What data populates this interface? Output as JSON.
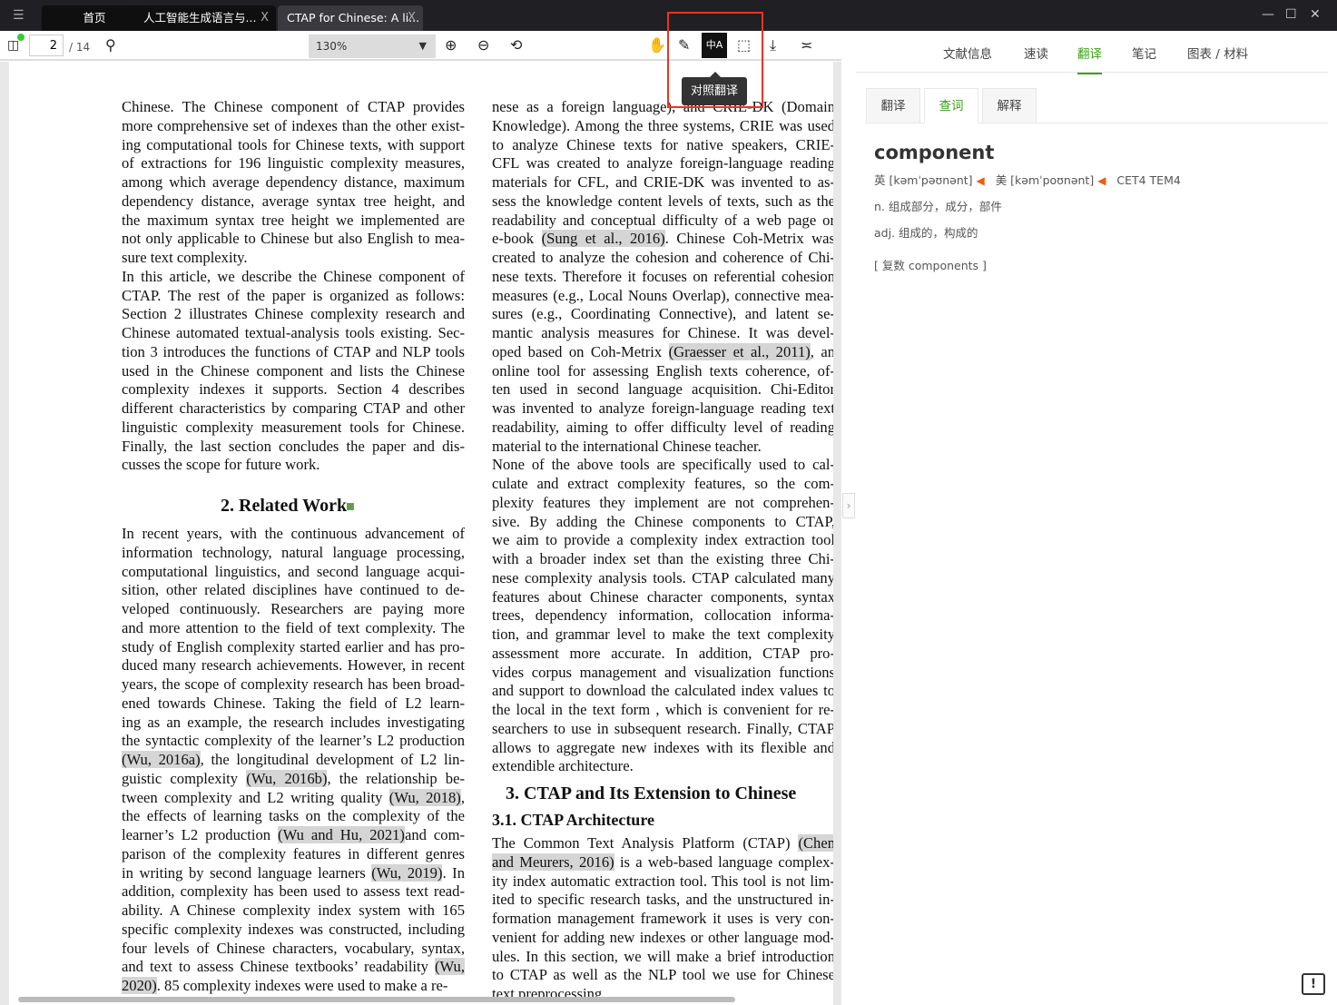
{
  "tabs": [
    {
      "label": "首页"
    },
    {
      "label": "人工智能生成语言与...",
      "close": "X"
    },
    {
      "label": "CTAP for Chinese: A li...",
      "close": "X"
    }
  ],
  "window_controls": {
    "minimize": "—",
    "maximize": "☐",
    "close": "✕"
  },
  "toolbar": {
    "page": "2",
    "page_total": "/ 14",
    "zoom": "130%",
    "translate_icon": "中A",
    "tooltip": "对照翻译"
  },
  "icons": [
    "sidebar-toggle-icon",
    "search-icon",
    "zoom-in-icon",
    "zoom-out-icon",
    "rotate-icon",
    "hand-icon",
    "pen-icon",
    "translate-icon",
    "select-area-icon",
    "download-icon",
    "eye-icon"
  ],
  "colors": {
    "accent": "#3aa017",
    "highlight_box": "#e32222",
    "cite_bg": "#d5d5d5",
    "speaker": "#f05a14"
  },
  "doc": {
    "left_paras": [
      [
        "Chinese. The Chinese component of CTAP provides",
        "more comprehensive set of indexes than the other exist-",
        "ing computational tools for Chinese texts, with support",
        "of extractions for 196 linguistic complexity measures,",
        "among which average dependency distance, maximum",
        "dependency distance, average syntax tree height, and",
        "the maximum syntax tree height we implemented are",
        "not only applicable to Chinese but also English to mea-",
        "sure text complexity."
      ],
      [
        "In this article, we describe the Chinese component of",
        "CTAP. The rest of the paper is organized as follows:",
        "Section 2 illustrates Chinese complexity research and",
        "Chinese automated textual-analysis tools existing. Sec-",
        "tion 3 introduces the functions of CTAP and NLP tools",
        "used in the Chinese component and lists the Chinese",
        "complexity indexes it supports.  Section 4 describes",
        "different characteristics by comparing CTAP and other",
        "linguistic complexity measurement tools for Chinese.",
        "Finally, the last section concludes the paper and dis-",
        "cusses the scope for future work."
      ]
    ],
    "heading2": "2.    Related Work",
    "left_paras2": [
      [
        "In recent years, with the continuous advancement of",
        "information technology, natural language processing,",
        "computational linguistics, and second language acqui-",
        "sition, other related disciplines have continued to de-",
        "veloped continuously.  Researchers are paying more",
        "and more attention to the field of text complexity. The",
        "study of English complexity started earlier and has pro-",
        "duced many research achievements. However, in recent",
        "years, the scope of complexity research has been broad-",
        "ened towards Chinese.  Taking the field of L2 learn-",
        "ing as an example, the research includes investigating",
        "the syntactic complexity of the learner’s L2 production",
        "(Wu, 2016a), the longitudinal development of L2 lin-",
        "guistic complexity (Wu, 2016b), the relationship be-",
        "tween complexity and L2 writing quality (Wu, 2018),",
        "the effects of learning tasks on the complexity of the",
        "learner’s L2 production (Wu and Hu, 2021)and com-",
        "parison of the complexity features in different genres",
        "in writing by second language learners (Wu, 2019). In",
        "addition, complexity has been used to assess text read-",
        "ability.  A Chinese complexity index system with 165",
        "specific complexity indexes was constructed, including",
        "four levels of Chinese characters, vocabulary, syntax,",
        "and text to assess Chinese textbooks’ readability (Wu,",
        "2020). 85 complexity indexes were used to make a re-"
      ]
    ],
    "right_paras": [
      [
        "nese as a foreign language), and CRIE-DK (Domain",
        "Knowledge). Among the three systems, CRIE was used",
        "to analyze Chinese texts for native speakers, CRIE-",
        "CFL was created to analyze foreign-language reading",
        "materials for CFL, and CRIE-DK was invented to as-",
        "sess the knowledge content levels of texts, such as the",
        "readability and conceptual difficulty of a web page or",
        "e-book (Sung et al., 2016).  Chinese Coh-Metrix was",
        "created to analyze the cohesion and coherence of Chi-",
        "nese texts. Therefore it focuses on referential cohesion",
        "measures (e.g., Local Nouns Overlap), connective mea-",
        "sures (e.g., Coordinating Connective), and latent se-",
        "mantic analysis measures for Chinese.  It was devel-",
        "oped based on Coh-Metrix (Graesser et al., 2011), an",
        "online tool for assessing English texts coherence, of-",
        "ten used in second language acquisition.  Chi-Editor",
        "was invented to analyze foreign-language reading text",
        "readability, aiming to offer difficulty level of reading",
        "material to the international Chinese teacher."
      ],
      [
        "None of the above tools are specifically used to cal-",
        "culate and extract complexity features, so the com-",
        "plexity features they implement are not comprehen-",
        "sive.  By adding the Chinese components to CTAP,",
        "we aim to provide a complexity index extraction tool",
        "with a broader index set than the existing three Chi-",
        "nese complexity analysis tools. CTAP calculated many",
        "features about Chinese character components, syntax",
        "trees, dependency information, collocation informa-",
        "tion, and grammar level to make the text complexity",
        "assessment more accurate.  In addition, CTAP pro-",
        "vides corpus management and visualization functions",
        "and support to download the calculated index values to",
        "the local in the text form , which is convenient for re-",
        "searchers to use in subsequent research. Finally, CTAP",
        "allows to aggregate new indexes with its flexible and",
        "extendible architecture."
      ]
    ],
    "heading3": "3.    CTAP and Its Extension to Chinese",
    "heading31": "3.1.    CTAP Architecture",
    "right_paras2": [
      [
        "The Common Text Analysis Platform (CTAP) (Chen",
        "and Meurers, 2016) is a web-based language complex-",
        "ity index automatic extraction tool. This tool is not lim-",
        "ited to specific research tasks, and the unstructured in-",
        "formation management framework it uses is very con-",
        "venient for adding new indexes or other language mod-",
        "ules. In this section, we will make a brief introduction",
        "to CTAP as well as the NLP tool we use for Chinese",
        "text preprocessing."
      ]
    ],
    "citations": [
      "(Graesser et al., 2011)",
      "and Meurers, 2016)",
      "(Sung et al., 2016)",
      "(Wu and Hu, 2021)",
      "(Wu, 2016a)",
      "(Wu, 2016b)",
      "(Wu, 2018)",
      "(Wu, 2019)",
      "(Wu,",
      "2020)",
      "(Chen"
    ]
  },
  "panel": {
    "tabs": [
      {
        "label": "文献信息"
      },
      {
        "label": "速读"
      },
      {
        "label": "翻译"
      },
      {
        "label": "笔记"
      },
      {
        "label": "图表 / 材料"
      }
    ],
    "subtabs": [
      {
        "label": "翻译"
      },
      {
        "label": "查词"
      },
      {
        "label": "解释"
      }
    ],
    "word": "component",
    "uk": "英 [kəmˈpəʊnənt]",
    "us": "美 [kəmˈpoʊnənt]",
    "levels": "CET4 TEM4",
    "def_n": "n. 组成部分，成分，部件",
    "def_adj": "adj. 组成的，构成的",
    "plural": "[ 复数 components ]"
  },
  "feedback": "!"
}
